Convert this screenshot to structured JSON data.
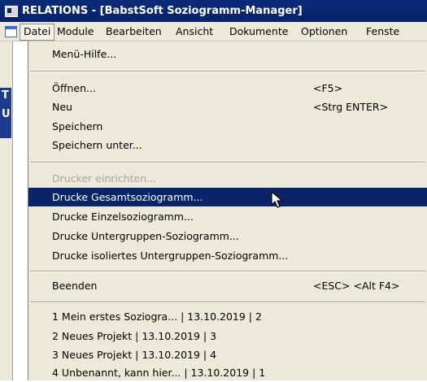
{
  "window": {
    "title": "RELATIONS - [BabstSoft Soziogramm-Manager]"
  },
  "menubar": {
    "items": [
      {
        "label": "Datei"
      },
      {
        "label": "Module"
      },
      {
        "label": "Bearbeiten"
      },
      {
        "label": "Ansicht"
      },
      {
        "label": "Dokumente"
      },
      {
        "label": "Optionen"
      },
      {
        "label": "Fenste"
      }
    ]
  },
  "background": {
    "letters": [
      "T",
      "U"
    ]
  },
  "dropdown": {
    "help": "Menü-Hilfe...",
    "open": {
      "label": "Öffnen...",
      "shortcut": "<F5>"
    },
    "new": {
      "label": "Neu",
      "shortcut": "<Strg ENTER>"
    },
    "save": "Speichern",
    "save_as": "Speichern unter...",
    "printer_setup": "Drucker einrichten...",
    "print_total": "Drucke Gesamtsoziogramm...",
    "print_single": "Drucke Einzelsoziogramm...",
    "print_subgroup": "Drucke Untergruppen-Soziogramm...",
    "print_isolated": "Drucke isoliertes Untergruppen-Soziogramm...",
    "exit": {
      "label": "Beenden",
      "shortcut": "<ESC> <Alt F4>"
    },
    "recent": [
      "1 Mein erstes Soziogra... | 13.10.2019 | 2",
      "2 Neues Projekt | 13.10.2019 | 3",
      "3 Neues Projekt | 13.10.2019 | 4",
      "4 Unbenannt, kann hier... | 13.10.2019 | 1"
    ]
  },
  "colors": {
    "titlebar": "#0b2a78",
    "menu_bg": "#ece9d8",
    "highlight": "#0a246a",
    "disabled": "#a9a79c"
  }
}
